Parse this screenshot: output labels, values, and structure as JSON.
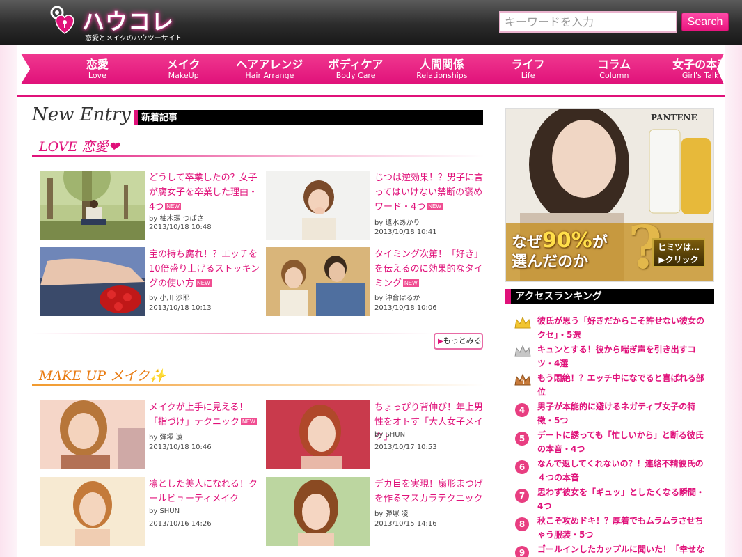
{
  "header": {
    "logo_title": "ハウコレ",
    "logo_subtitle": "恋愛とメイクのハウツーサイト",
    "search_placeholder": "キーワードを入力",
    "search_button": "Search"
  },
  "nav": [
    {
      "jp": "恋愛",
      "en": "Love"
    },
    {
      "jp": "メイク",
      "en": "MakeUp"
    },
    {
      "jp": "ヘアアレンジ",
      "en": "Hair Arrange"
    },
    {
      "jp": "ボディケア",
      "en": "Body Care"
    },
    {
      "jp": "人間関係",
      "en": "Relationships"
    },
    {
      "jp": "ライフ",
      "en": "Life"
    },
    {
      "jp": "コラム",
      "en": "Column"
    },
    {
      "jp": "女子の本音",
      "en": "Girl's Talk"
    }
  ],
  "new_entry": {
    "script_title": "New Entry",
    "label": "新着記事"
  },
  "love": {
    "title": "LOVE 恋愛❤",
    "more": "もっとみる",
    "articles": [
      {
        "title": "どうして卒業したの？女子が腐女子を卒業した理由・4つ",
        "badge": "NEW",
        "author": "by 柚木琛 つばさ",
        "date": "2013/10/18 10:48"
      },
      {
        "title": "じつは逆効果！？男子に言ってはいけない禁断の褒めワード・4つ",
        "badge": "NEW",
        "author": "by 遣水あかり",
        "date": "2013/10/18 10:41"
      },
      {
        "title": "宝の持ち腐れ！？エッチを10倍盛り上げるストッキングの使い方",
        "badge": "NEW",
        "author": "by 小川 沙耶",
        "date": "2013/10/18 10:13"
      },
      {
        "title": "タイミング次第！「好き」を伝えるのに効果的なタイミング",
        "badge": "NEW",
        "author": "by 沖合はるか",
        "date": "2013/10/18 10:06"
      }
    ]
  },
  "makeup": {
    "title": "MAKE UP メイク✨",
    "articles": [
      {
        "title": "メイクが上手に見える！「指づけ」テクニック",
        "badge": "NEW",
        "author": "by 弾塚 凌",
        "date": "2013/10/18 10:46"
      },
      {
        "title": "ちょっぴり背伸び！年上男性をオトす「大人女子メイク」",
        "badge": "",
        "author": "by SHUN",
        "date": "2013/10/17 10:53"
      },
      {
        "title": "凛とした美人になれる！クールビューティメイク",
        "badge": "",
        "author": "by SHUN",
        "date": "2013/10/16 14:26"
      },
      {
        "title": "デカ目を実現！扇形まつげを作るマスカラテクニック",
        "badge": "",
        "author": "by 弾塚 凌",
        "date": "2013/10/15 14:16"
      }
    ]
  },
  "ad": {
    "brand": "PANTENE",
    "copy_line1": "なぜ",
    "copy_pct": "90%",
    "copy_line1b": "が",
    "copy_line2": "選んだのか",
    "qmark": "?",
    "button_line1": "ヒミツは…",
    "button_line2": "▶クリック"
  },
  "ranking": {
    "title": "アクセスランキング",
    "items": [
      {
        "rank": "1",
        "text": "彼氏が思う「好きだからこそ許せない彼女のクセ」・5選"
      },
      {
        "rank": "2",
        "text": "キュンとする！彼から喘ぎ声を引き出すコツ・4選"
      },
      {
        "rank": "3",
        "text": "もう悶絶！？エッチ中になでると喜ばれる部位"
      },
      {
        "rank": "4",
        "text": "男子が本能的に避けるネガティブ女子の特徴・5つ"
      },
      {
        "rank": "5",
        "text": "デートに誘っても「忙しいから」と断る彼氏の本音・4つ"
      },
      {
        "rank": "6",
        "text": "なんで返してくれないの？！連絡不精彼氏の４つの本音"
      },
      {
        "rank": "7",
        "text": "思わず彼女を「ギュッ」としたくなる瞬間・4つ"
      },
      {
        "rank": "8",
        "text": "秋こそ攻めドキ！？厚着でもムラムラさせちゃう服装・5つ"
      },
      {
        "rank": "9",
        "text": "ゴールインしたカップルに聞いた！「幸せな"
      }
    ]
  },
  "colors": {
    "brand_pink": "#e0117a",
    "header_dark": "#2c2c2c"
  }
}
